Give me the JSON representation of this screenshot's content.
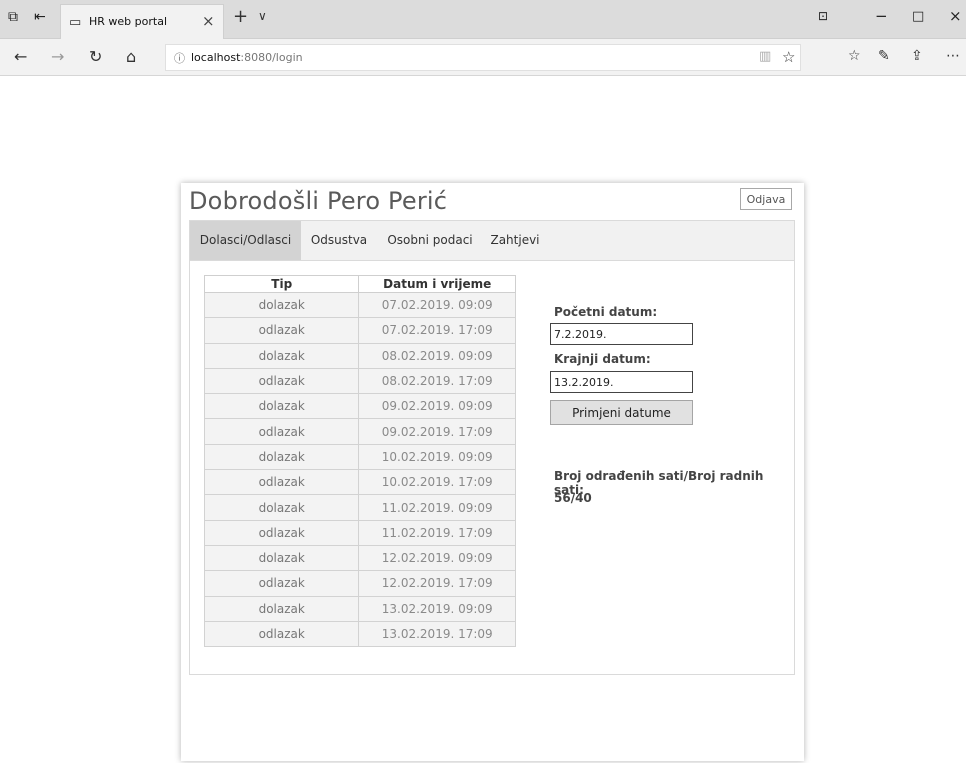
{
  "browser": {
    "tab_title": "HR web portal",
    "url_host": "localhost",
    "url_path": ":8080/login"
  },
  "page": {
    "welcome": "Dobrodošli Pero Perić",
    "logout_label": "Odjava",
    "tabs": [
      {
        "label": "Dolasci/Odlasci",
        "active": true
      },
      {
        "label": "Odsustva",
        "active": false
      },
      {
        "label": "Osobni podaci",
        "active": false
      },
      {
        "label": "Zahtjevi",
        "active": false
      }
    ],
    "table": {
      "headers": [
        "Tip",
        "Datum i vrijeme"
      ],
      "rows": [
        [
          "dolazak",
          "07.02.2019. 09:09"
        ],
        [
          "odlazak",
          "07.02.2019. 17:09"
        ],
        [
          "dolazak",
          "08.02.2019. 09:09"
        ],
        [
          "odlazak",
          "08.02.2019. 17:09"
        ],
        [
          "dolazak",
          "09.02.2019. 09:09"
        ],
        [
          "odlazak",
          "09.02.2019. 17:09"
        ],
        [
          "dolazak",
          "10.02.2019. 09:09"
        ],
        [
          "odlazak",
          "10.02.2019. 17:09"
        ],
        [
          "dolazak",
          "11.02.2019. 09:09"
        ],
        [
          "odlazak",
          "11.02.2019. 17:09"
        ],
        [
          "dolazak",
          "12.02.2019. 09:09"
        ],
        [
          "odlazak",
          "12.02.2019. 17:09"
        ],
        [
          "dolazak",
          "13.02.2019. 09:09"
        ],
        [
          "odlazak",
          "13.02.2019. 17:09"
        ]
      ]
    },
    "filters": {
      "start_label": "Početni datum:",
      "start_value": "7.2.2019.",
      "end_label": "Krajnji datum:",
      "end_value": "13.2.2019.",
      "apply_label": "Primjeni datume"
    },
    "hours": {
      "label": "Broj odrađenih sati/Broj radnih sati:",
      "value": "56/40"
    }
  },
  "colors": {
    "active_tab": "#d3d3d3",
    "tab_strip": "#f1f1f1",
    "table_cell": "#f3f3f3"
  }
}
